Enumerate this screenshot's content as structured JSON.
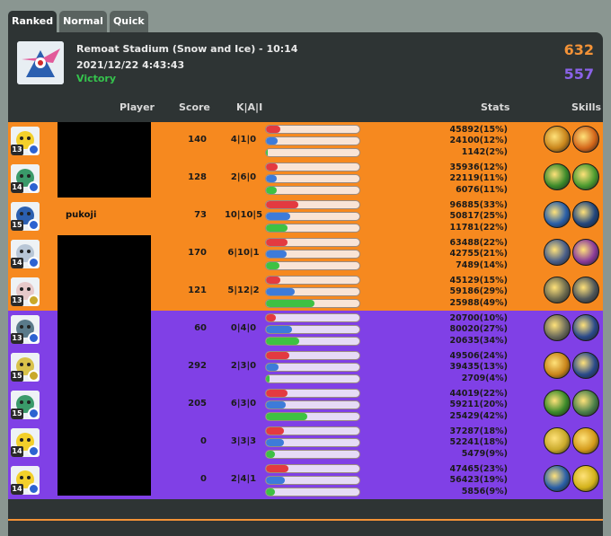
{
  "tabs": [
    {
      "label": "Ranked",
      "active": true
    },
    {
      "label": "Normal",
      "active": false
    },
    {
      "label": "Quick",
      "active": false
    }
  ],
  "match": {
    "stage": "Remoat Stadium (Snow and Ice) - 10:14",
    "datetime": "2021/12/22 4:43:43",
    "result": "Victory",
    "score_orange": "632",
    "score_purple": "557"
  },
  "columns": {
    "player": "Player",
    "score": "Score",
    "kda": "K|A|I",
    "stats": "Stats",
    "skills": "Skills"
  },
  "colors": {
    "orange_team": "#f6891f",
    "purple_team": "#8040e6",
    "victory": "#35c44d",
    "damage_bar": "#e33a40",
    "taken_bar": "#3d7bd9",
    "heal_bar": "#3ec143"
  },
  "orange_players": [
    {
      "level": "13",
      "name": "",
      "score": "140",
      "kda": "4|1|0",
      "dmg": "45892(15%)",
      "taken": "24100(12%)",
      "heal": "1142(2%)",
      "pct": [
        15,
        12,
        2
      ],
      "avatar": "pikachu",
      "badge": "blue",
      "skill_colors": [
        "#c9851b",
        "#d3661a"
      ]
    },
    {
      "level": "14",
      "name": "",
      "score": "128",
      "kda": "2|6|0",
      "dmg": "35936(12%)",
      "taken": "22119(11%)",
      "heal": "6076(11%)",
      "pct": [
        12,
        11,
        11
      ],
      "avatar": "venusaur",
      "badge": "blue",
      "skill_colors": [
        "#3b8a2a",
        "#4a9a2f"
      ]
    },
    {
      "level": "15",
      "name": "pukoji",
      "score": "73",
      "kda": "10|10|5",
      "dmg": "96885(33%)",
      "taken": "50817(25%)",
      "heal": "11781(22%)",
      "pct": [
        33,
        25,
        22
      ],
      "avatar": "greninja",
      "badge": "blue",
      "skill_colors": [
        "#2a5fa8",
        "#23477e"
      ]
    },
    {
      "level": "14",
      "name": "",
      "score": "170",
      "kda": "6|10|1",
      "dmg": "63488(22%)",
      "taken": "42755(21%)",
      "heal": "7489(14%)",
      "pct": [
        22,
        21,
        14
      ],
      "avatar": "absol",
      "badge": "blue",
      "skill_colors": [
        "#4a5f8a",
        "#8a3b9a"
      ]
    },
    {
      "level": "13",
      "name": "",
      "score": "121",
      "kda": "5|12|2",
      "dmg": "45129(15%)",
      "taken": "59186(29%)",
      "heal": "25988(49%)",
      "pct": [
        15,
        29,
        49
      ],
      "avatar": "mr-mime",
      "badge": "gold",
      "skill_colors": [
        "#6c6a4e",
        "#50575a"
      ]
    }
  ],
  "purple_players": [
    {
      "level": "13",
      "name": "",
      "score": "60",
      "kda": "0|4|0",
      "dmg": "20700(10%)",
      "taken": "80020(27%)",
      "heal": "20635(34%)",
      "pct": [
        10,
        27,
        34
      ],
      "avatar": "snorlax",
      "badge": "blue",
      "skill_colors": [
        "#6a6a5a",
        "#2a4a8a"
      ]
    },
    {
      "level": "15",
      "name": "",
      "score": "292",
      "kda": "2|3|0",
      "dmg": "49506(24%)",
      "taken": "39435(13%)",
      "heal": "2709(4%)",
      "pct": [
        24,
        13,
        4
      ],
      "avatar": "zeraora",
      "badge": "gold",
      "skill_colors": [
        "#c9851b",
        "#2a4a8a"
      ]
    },
    {
      "level": "15",
      "name": "",
      "score": "205",
      "kda": "6|3|0",
      "dmg": "44019(22%)",
      "taken": "59211(20%)",
      "heal": "25429(42%)",
      "pct": [
        22,
        20,
        42
      ],
      "avatar": "venusaur",
      "badge": "blue",
      "skill_colors": [
        "#3b8a2a",
        "#4a7f4a"
      ]
    },
    {
      "level": "14",
      "name": "",
      "score": "0",
      "kda": "3|3|3",
      "dmg": "37287(18%)",
      "taken": "52241(18%)",
      "heal": "5479(9%)",
      "pct": [
        18,
        18,
        9
      ],
      "avatar": "pikachu",
      "badge": "blue",
      "skill_colors": [
        "#c9a92a",
        "#d39a1a"
      ]
    },
    {
      "level": "14",
      "name": "",
      "score": "0",
      "kda": "2|4|1",
      "dmg": "47465(23%)",
      "taken": "56423(19%)",
      "heal": "5856(9%)",
      "pct": [
        23,
        19,
        9
      ],
      "avatar": "pikachu",
      "badge": "blue",
      "skill_colors": [
        "#2a5fa8",
        "#d3b21a"
      ]
    }
  ]
}
